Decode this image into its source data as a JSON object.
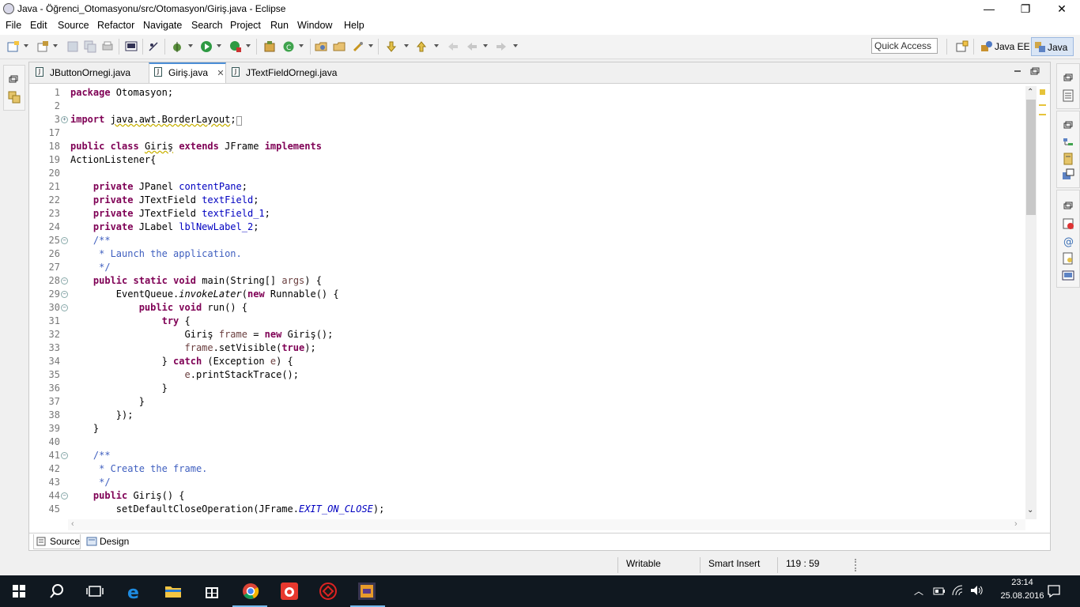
{
  "window": {
    "title": "Java - Öğrenci_Otomasyonu/src/Otomasyon/Giriş.java - Eclipse",
    "minimize": "—",
    "maximize": "❐",
    "close": "✕"
  },
  "menu": [
    "File",
    "Edit",
    "Source",
    "Refactor",
    "Navigate",
    "Search",
    "Project",
    "Run",
    "Window",
    "Help"
  ],
  "toolbar": {
    "quick_access": "Quick Access",
    "perspectives": [
      "Java EE",
      "Java"
    ]
  },
  "editor": {
    "tabs": [
      {
        "label": "JButtonOrnegi.java",
        "active": false
      },
      {
        "label": "Giriş.java",
        "active": true
      },
      {
        "label": "JTextFieldOrnegi.java",
        "active": false
      }
    ],
    "bottom_tabs": [
      "Source",
      "Design"
    ]
  },
  "code_lines": [
    {
      "n": "1",
      "html": "<span class='kw'>package</span> Otomasyon;"
    },
    {
      "n": "2",
      "html": ""
    },
    {
      "n": "3",
      "fold": "+",
      "marker": "warn",
      "html": "<span class='kw'>import</span> <span class='warn'>java.awt.BorderLayout</span>;<span style='border:1px solid #999;font-size:9px;'>&nbsp;</span>"
    },
    {
      "n": "17",
      "html": ""
    },
    {
      "n": "18",
      "marker": "warn",
      "html": "<span class='kw'>public</span> <span class='kw'>class</span> <span class='warn'>Giriş</span> <span class='kw'>extends</span> JFrame <span class='kw'>implements</span>"
    },
    {
      "n": "19",
      "html": "ActionListener{"
    },
    {
      "n": "20",
      "html": ""
    },
    {
      "n": "21",
      "html": "    <span class='kw'>private</span> JPanel <span class='fld'>contentPane</span>;"
    },
    {
      "n": "22",
      "html": "    <span class='kw'>private</span> JTextField <span class='fld'>textField</span>;"
    },
    {
      "n": "23",
      "html": "    <span class='kw'>private</span> JTextField <span class='fld'>textField_1</span>;"
    },
    {
      "n": "24",
      "html": "    <span class='kw'>private</span> JLabel <span class='fld'>lblNewLabel_2</span>;"
    },
    {
      "n": "25",
      "fold": "−",
      "html": "    <span class='cmt'>/**</span>"
    },
    {
      "n": "26",
      "html": "<span class='cmt'>     * Launch the application.</span>"
    },
    {
      "n": "27",
      "html": "<span class='cmt'>     */</span>"
    },
    {
      "n": "28",
      "fold": "−",
      "html": "    <span class='kw'>public</span> <span class='kw'>static</span> <span class='kw'>void</span> main(String[] <span class='var'>args</span>) {"
    },
    {
      "n": "29",
      "fold": "−",
      "html": "        EventQueue.<span class='mthital'>invokeLater</span>(<span class='kw'>new</span> Runnable() {"
    },
    {
      "n": "30",
      "fold": "−",
      "marker": "override",
      "html": "            <span class='kw'>public</span> <span class='kw'>void</span> run() {"
    },
    {
      "n": "31",
      "html": "                <span class='kw'>try</span> {"
    },
    {
      "n": "32",
      "html": "                    Giriş <span class='var'>frame</span> = <span class='kw'>new</span> Giriş();"
    },
    {
      "n": "33",
      "html": "                    <span class='var'>frame</span>.setVisible(<span class='kw'>true</span>);"
    },
    {
      "n": "34",
      "html": "                } <span class='kw'>catch</span> (Exception <span class='var'>e</span>) {"
    },
    {
      "n": "35",
      "html": "                    <span class='var'>e</span>.printStackTrace();"
    },
    {
      "n": "36",
      "html": "                }"
    },
    {
      "n": "37",
      "html": "            }"
    },
    {
      "n": "38",
      "html": "        });"
    },
    {
      "n": "39",
      "html": "    }"
    },
    {
      "n": "40",
      "html": ""
    },
    {
      "n": "41",
      "fold": "−",
      "html": "    <span class='cmt'>/**</span>"
    },
    {
      "n": "42",
      "html": "<span class='cmt'>     * Create the frame.</span>"
    },
    {
      "n": "43",
      "html": "<span class='cmt'>     */</span>"
    },
    {
      "n": "44",
      "fold": "−",
      "html": "    <span class='kw'>public</span> Giriş() {"
    },
    {
      "n": "45",
      "html": "        setDefaultCloseOperation(JFrame.<span class='ital'>EXIT_ON_CLOSE</span>);"
    }
  ],
  "status": {
    "writable": "Writable",
    "insert_mode": "Smart Insert",
    "cursor": "119 : 59"
  },
  "taskbar": {
    "time": "23:14",
    "date": "25.08.2016"
  },
  "colors": {
    "keyword": "#7f0055",
    "field": "#0000c0",
    "comment": "#3f5fbf",
    "taskbar": "#101820",
    "active_tab_accent": "#4b8ed6"
  }
}
